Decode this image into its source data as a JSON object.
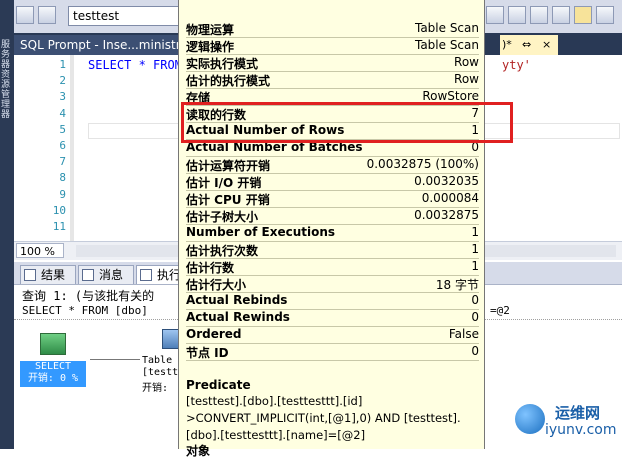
{
  "side": {
    "vertical_text": "服务器资源管理器"
  },
  "toolbar": {
    "database": "testtest"
  },
  "doc_tab": {
    "title": "SQL Prompt - Inse...ministra",
    "right_title": ")*",
    "pin": "⇔",
    "close": "×"
  },
  "editor": {
    "line_numbers": [
      "1",
      "2",
      "3",
      "4",
      "5",
      "6",
      "7",
      "8",
      "9",
      "10",
      "11"
    ],
    "code": "SELECT * FROM",
    "code_tail": "yty'"
  },
  "zoom": "100 %",
  "results_tabs": [
    "结果",
    "消息",
    "执行"
  ],
  "results": {
    "query_line": "查询 1: (与该批有关的",
    "sql_line": "SELECT * FROM [dbo]",
    "sql_line_tail": "=@2",
    "select_op": {
      "name": "SELECT",
      "cost": "开销: 0 %"
    },
    "scan_op": {
      "name": "Table",
      "detail": "[testtes",
      "cost": "开销:"
    }
  },
  "tooltip": {
    "rows": [
      {
        "key": "物理运算",
        "value": "Table Scan"
      },
      {
        "key": "逻辑操作",
        "value": "Table Scan"
      },
      {
        "key": "实际执行模式",
        "value": "Row"
      },
      {
        "key": "估计的执行模式",
        "value": "Row"
      },
      {
        "key": "存储",
        "value": "RowStore"
      },
      {
        "key": "读取的行数",
        "value": "7"
      },
      {
        "key": "Actual Number of Rows",
        "value": "1"
      },
      {
        "key": "Actual Number of Batches",
        "value": "0"
      },
      {
        "key": "估计运算符开销",
        "value": "0.0032875 (100%)"
      },
      {
        "key": "估计 I/O 开销",
        "value": "0.0032035"
      },
      {
        "key": "估计 CPU 开销",
        "value": "0.000084"
      },
      {
        "key": "估计子树大小",
        "value": "0.0032875"
      },
      {
        "key": "Number of Executions",
        "value": "1"
      },
      {
        "key": "估计执行次数",
        "value": "1"
      },
      {
        "key": "估计行数",
        "value": "1"
      },
      {
        "key": "估计行大小",
        "value": "18 字节"
      },
      {
        "key": "Actual Rebinds",
        "value": "0"
      },
      {
        "key": "Actual Rewinds",
        "value": "0"
      },
      {
        "key": "Ordered",
        "value": "False"
      },
      {
        "key": "节点 ID",
        "value": "0"
      }
    ],
    "predicate_heading": "Predicate",
    "predicate_lines": [
      "[testtest].[dbo].[testtesttt].[id]",
      ">CONVERT_IMPLICIT(int,[@1],0) AND [testtest].",
      "[dbo].[testtesttt].[name]=[@2]"
    ],
    "object_heading": "对象"
  },
  "watermark": {
    "cn": "运维网",
    "en": "iyunv.com"
  }
}
